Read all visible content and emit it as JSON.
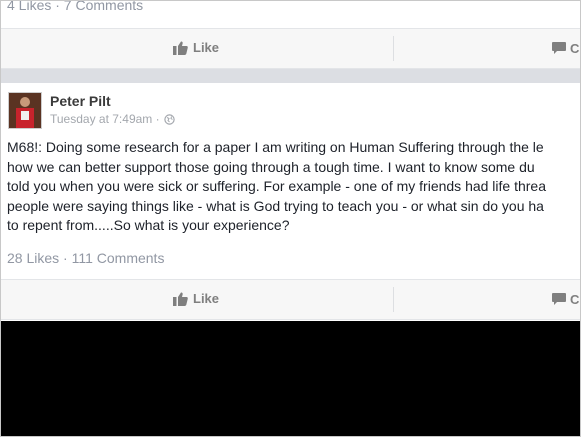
{
  "top_post": {
    "stats": "4 Likes · 7 Comments",
    "like_label": "Like",
    "comment_label": "C"
  },
  "post": {
    "author": "Peter Pilt",
    "timestamp": "Tuesday at 7:49am · ",
    "privacy_icon": "globe-icon",
    "text_lines": [
      "M68!: Doing some research for a paper I am writing on Human Suffering through the le",
      "how we can better support those going through a tough time. I want to know some du",
      "told you when you were sick or suffering. For example - one of my friends had life threa",
      "people were saying things like - what is God trying to teach you - or what sin do you ha",
      "to repent from.....So what is your experience?"
    ],
    "stats": "28 Likes · 111 Comments",
    "like_label": "Like",
    "comment_label": "C"
  },
  "colors": {
    "action_text": "#7f7f7f",
    "stats_text": "#9197a3",
    "separator": "#dcdee3",
    "avatar_bg": "#6a3c2a"
  }
}
